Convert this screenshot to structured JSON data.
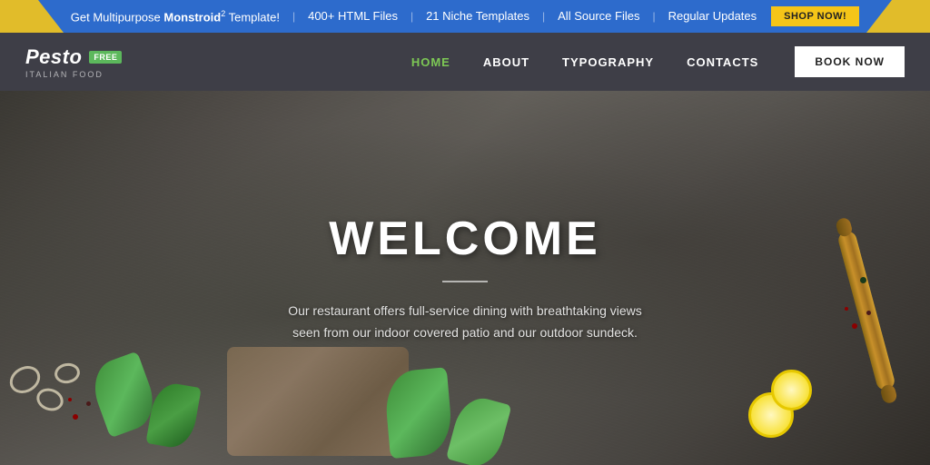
{
  "promo": {
    "text_pre": "Get Multipurpose ",
    "brand": "Monstroid",
    "brand_sup": "2",
    "text_post": " Template!",
    "feature1": "400+ HTML Files",
    "feature2": "21 Niche Templates",
    "feature3": "All Source Files",
    "feature4": "Regular Updates",
    "shop_btn": "SHOP NOW!"
  },
  "navbar": {
    "logo_name": "Pesto",
    "logo_badge": "FREE",
    "logo_sub": "ITALIAN FOOD",
    "nav_items": [
      {
        "label": "HOME",
        "active": true
      },
      {
        "label": "ABOUT",
        "active": false
      },
      {
        "label": "TYPOGRAPHY",
        "active": false
      },
      {
        "label": "CONTACTS",
        "active": false
      }
    ],
    "book_btn": "BOOK NOW"
  },
  "hero": {
    "title": "WELCOME",
    "subtitle": "Our restaurant offers full-service dining with breathtaking views\nseen from our indoor covered patio and our outdoor sundeck."
  },
  "colors": {
    "accent_green": "#7dc855",
    "promo_blue": "#2d6bcc",
    "shop_yellow": "#f5c518"
  }
}
